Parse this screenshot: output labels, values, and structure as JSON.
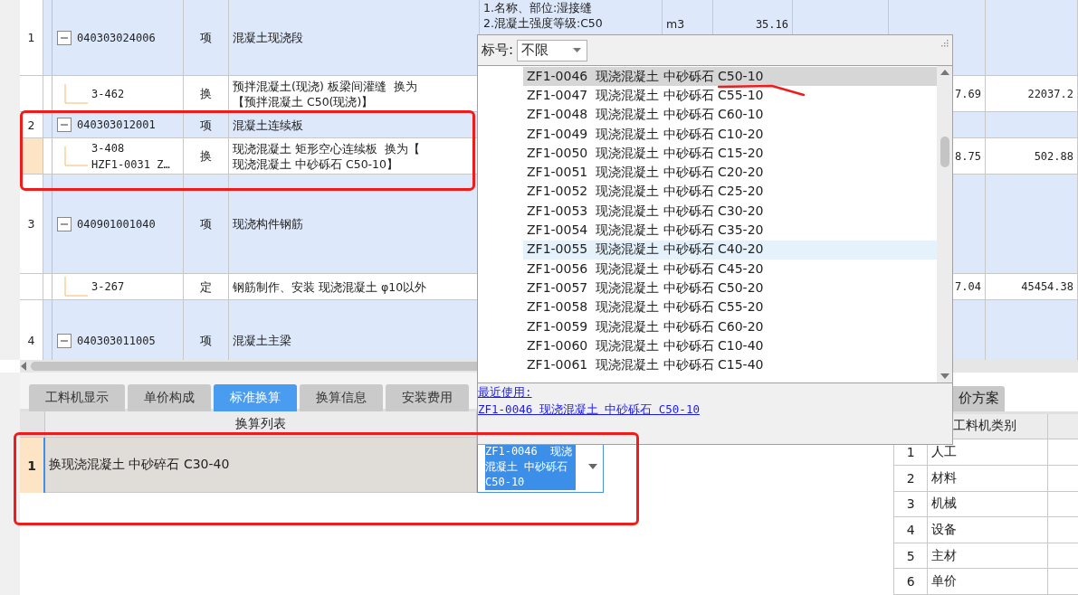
{
  "table": {
    "rows": [
      {
        "number": "1",
        "code": "040303024006",
        "type": "项",
        "name": "混凝土现浇段",
        "description": [
          "1.名称、部位:湿接缝",
          "2.混凝土强度等级:C50"
        ],
        "unit": "m3",
        "quantity": "35.16",
        "expanded": true,
        "children": [
          {
            "code": "3-462",
            "type": "换",
            "name": "预拌混凝土(现浇) 板梁间灌缝  换为【预拌混凝土 C50(现浇)】",
            "price": "7.69",
            "total": "22037.2",
            "current": false
          }
        ]
      },
      {
        "number": "2",
        "code": "040303012001",
        "type": "项",
        "name": "混凝土连续板",
        "expanded": true,
        "children": [
          {
            "code": "3-408",
            "code_2": "HZF1-0031 Z…",
            "type": "换",
            "name": "现浇混凝土 矩形空心连续板  换为【现浇混凝土 中砂砾石 C50-10】",
            "price": "8.75",
            "total": "502.88",
            "current": true
          }
        ]
      },
      {
        "number": "3",
        "code": "040901001040",
        "type": "项",
        "name": "现浇构件钢筋",
        "expanded": true,
        "children": [
          {
            "code": "3-267",
            "type": "定",
            "name": "钢筋制作、安装 现浇混凝土 φ10以外",
            "price": "7.04",
            "total": "45454.38",
            "current": false
          }
        ]
      },
      {
        "number": "4",
        "code": "040303011005",
        "type": "项",
        "name": "混凝土主梁",
        "expanded": true,
        "children": []
      }
    ]
  },
  "popup": {
    "filter_label": "标号:",
    "filter_value": "不限",
    "items": [
      {
        "label": "ZF1-0046  现浇混凝土 中砂砾石 C50-10",
        "selected": true,
        "hovered": false
      },
      {
        "label": "ZF1-0047  现浇混凝土 中砂砾石 C55-10",
        "selected": false,
        "hovered": false
      },
      {
        "label": "ZF1-0048  现浇混凝土 中砂砾石 C60-10",
        "selected": false,
        "hovered": false
      },
      {
        "label": "ZF1-0049  现浇混凝土 中砂砾石 C10-20",
        "selected": false,
        "hovered": false
      },
      {
        "label": "ZF1-0050  现浇混凝土 中砂砾石 C15-20",
        "selected": false,
        "hovered": false
      },
      {
        "label": "ZF1-0051  现浇混凝土 中砂砾石 C20-20",
        "selected": false,
        "hovered": false
      },
      {
        "label": "ZF1-0052  现浇混凝土 中砂砾石 C25-20",
        "selected": false,
        "hovered": false
      },
      {
        "label": "ZF1-0053  现浇混凝土 中砂砾石 C30-20",
        "selected": false,
        "hovered": false
      },
      {
        "label": "ZF1-0054  现浇混凝土 中砂砾石 C35-20",
        "selected": false,
        "hovered": false
      },
      {
        "label": "ZF1-0055  现浇混凝土 中砂砾石 C40-20",
        "selected": false,
        "hovered": true
      },
      {
        "label": "ZF1-0056  现浇混凝土 中砂砾石 C45-20",
        "selected": false,
        "hovered": false
      },
      {
        "label": "ZF1-0057  现浇混凝土 中砂砾石 C50-20",
        "selected": false,
        "hovered": false
      },
      {
        "label": "ZF1-0058  现浇混凝土 中砂砾石 C55-20",
        "selected": false,
        "hovered": false
      },
      {
        "label": "ZF1-0059  现浇混凝土 中砂砾石 C60-20",
        "selected": false,
        "hovered": false
      },
      {
        "label": "ZF1-0060  现浇混凝土 中砂砾石 C10-40",
        "selected": false,
        "hovered": false
      },
      {
        "label": "ZF1-0061  现浇混凝土 中砂砾石 C15-40",
        "selected": false,
        "hovered": false
      }
    ],
    "recent_label": "最近使用:",
    "recent_item": "ZF1-0046 现浇混凝土 中砂砾石 C50-10"
  },
  "bottom_tabs": [
    {
      "label": "工料机显示",
      "selected": false
    },
    {
      "label": "单价构成",
      "selected": false
    },
    {
      "label": "标准换算",
      "selected": true
    },
    {
      "label": "换算信息",
      "selected": false
    },
    {
      "label": "安装费用",
      "selected": false
    }
  ],
  "conversion_list": {
    "header": "换算列表",
    "rows": [
      {
        "number": "1",
        "name": "换现浇混凝土 中砂碎石 C30-40",
        "value": "ZF1-0046  现浇混凝土 中砂砾石 C50-10",
        "value_highlighted": true
      }
    ]
  },
  "right_panel": {
    "tab": "价方案",
    "header": "工料机类别",
    "rows": [
      {
        "number": "1",
        "name": "人工"
      },
      {
        "number": "2",
        "name": "材料"
      },
      {
        "number": "3",
        "name": "机械"
      },
      {
        "number": "4",
        "name": "设备"
      },
      {
        "number": "5",
        "name": "主材"
      },
      {
        "number": "6",
        "name": "单价"
      }
    ]
  },
  "annotations": [
    {
      "kind": "box"
    },
    {
      "kind": "box"
    },
    {
      "kind": "underline"
    }
  ]
}
